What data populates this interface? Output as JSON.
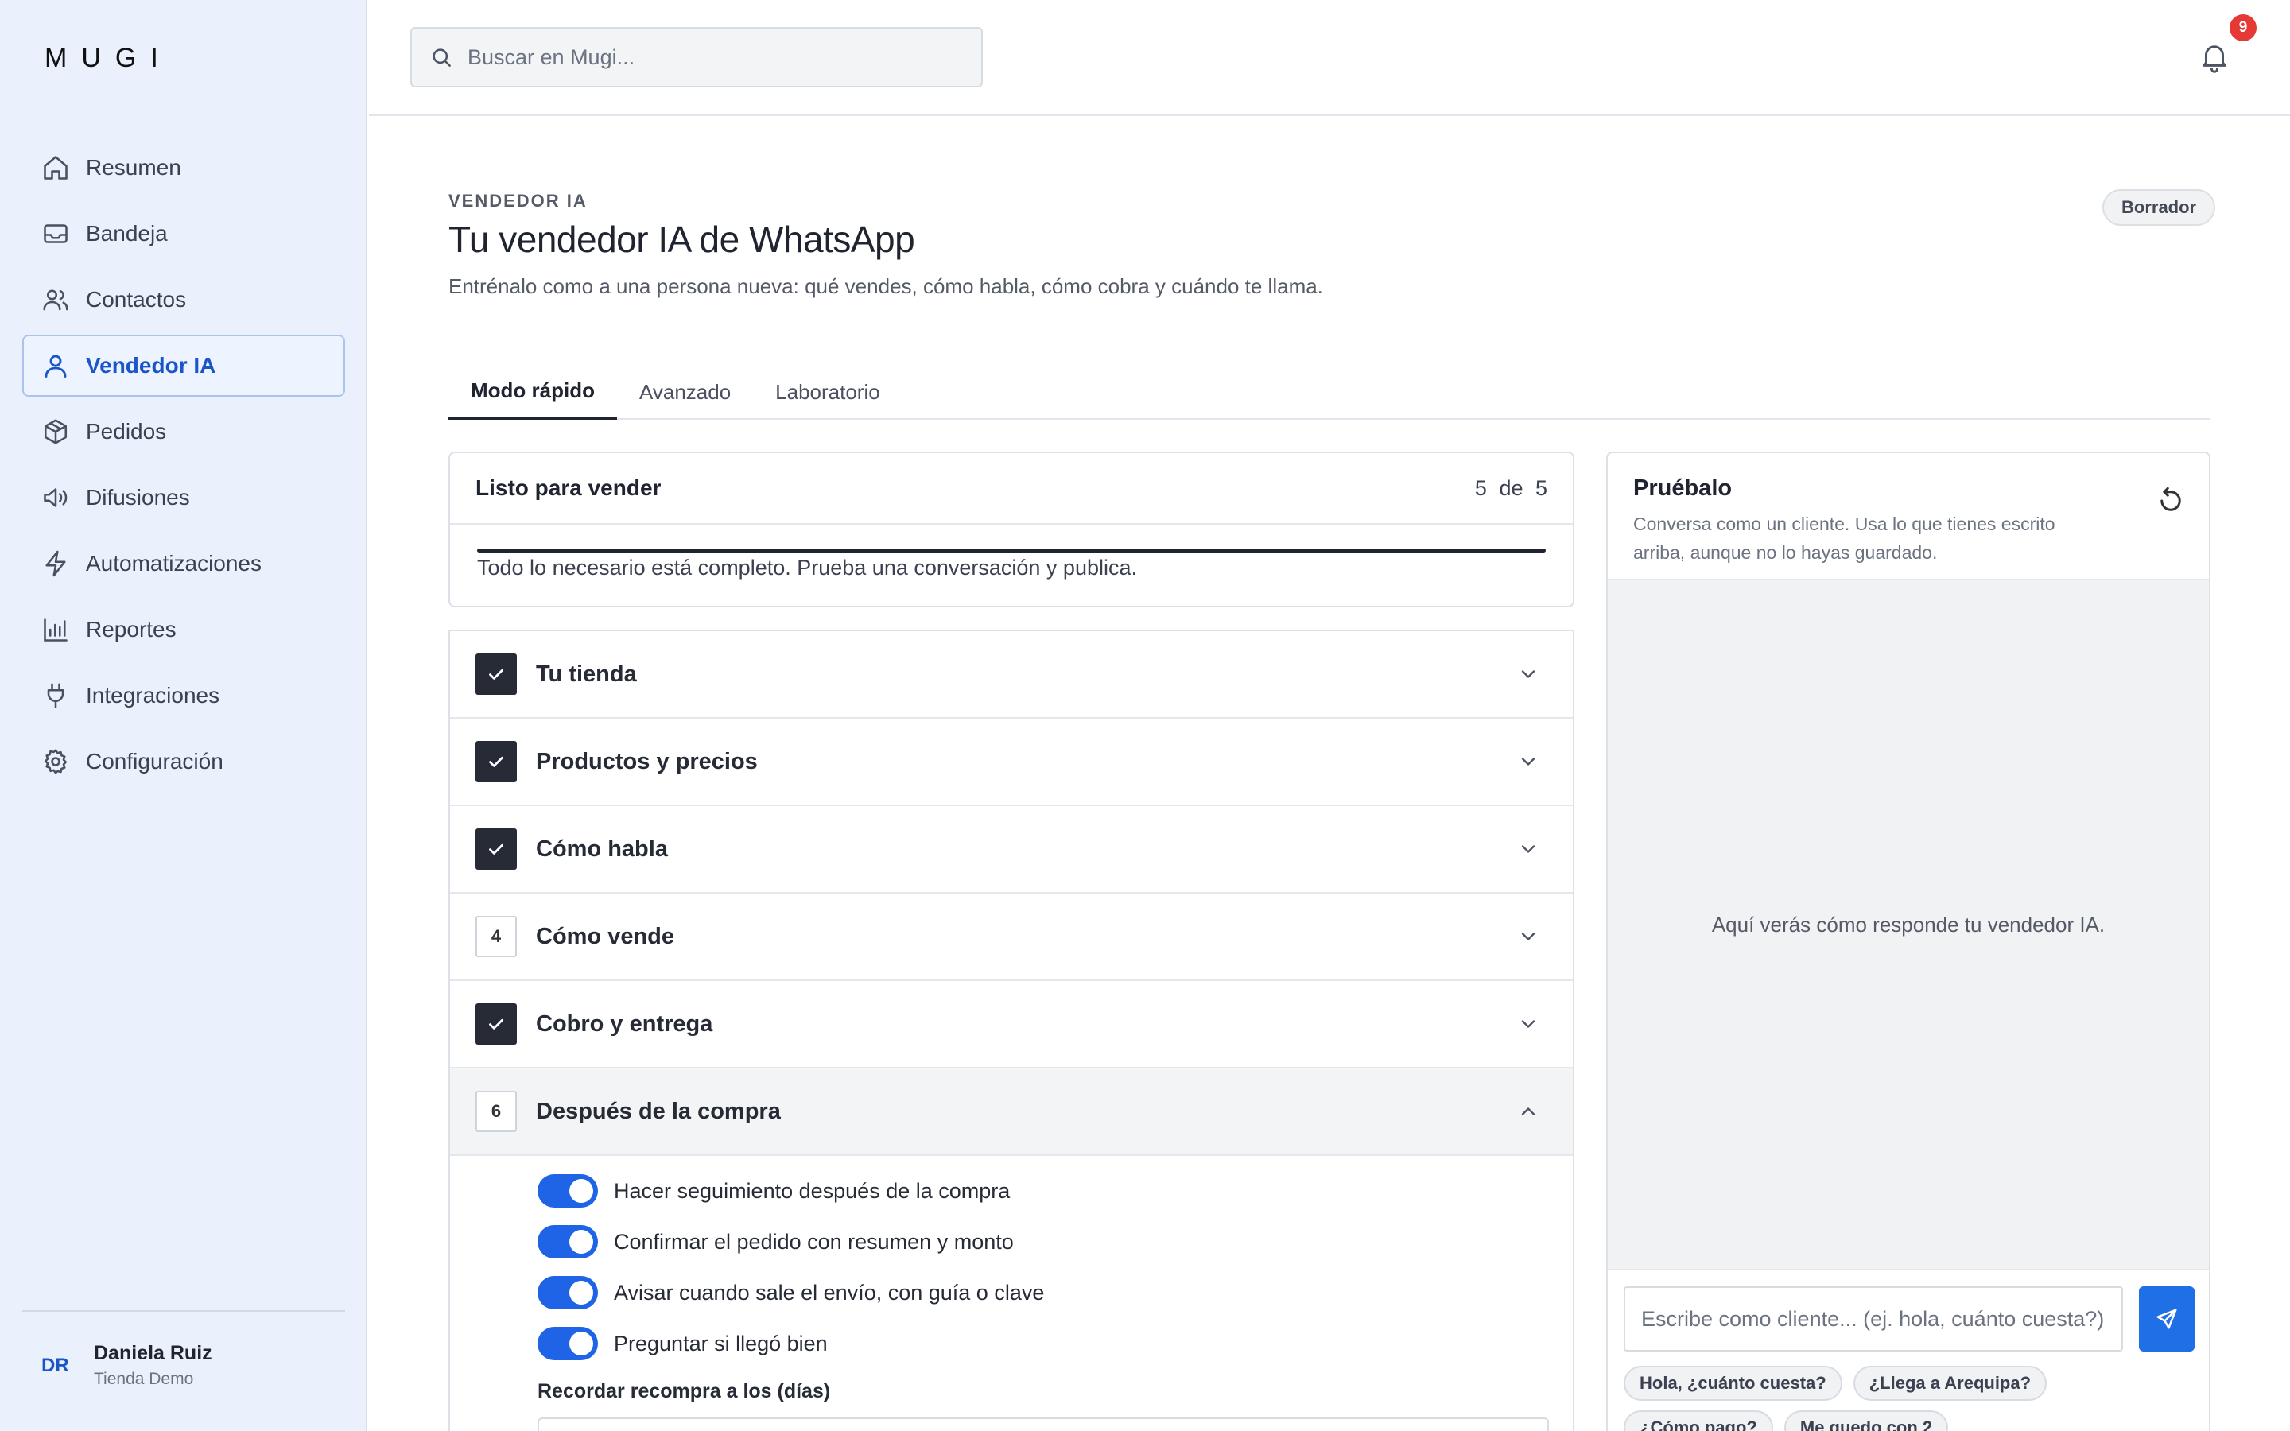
{
  "app": {
    "logo": "MUGI"
  },
  "sidebar": {
    "items": [
      {
        "label": "Resumen",
        "icon": "home-icon"
      },
      {
        "label": "Bandeja",
        "icon": "inbox-icon"
      },
      {
        "label": "Contactos",
        "icon": "users-icon"
      },
      {
        "label": "Vendedor IA",
        "icon": "user-icon",
        "active": true
      },
      {
        "label": "Pedidos",
        "icon": "package-icon"
      },
      {
        "label": "Difusiones",
        "icon": "megaphone-icon"
      },
      {
        "label": "Automatizaciones",
        "icon": "lightning-icon"
      },
      {
        "label": "Reportes",
        "icon": "bar-chart-icon"
      },
      {
        "label": "Integraciones",
        "icon": "plug-icon"
      },
      {
        "label": "Configuración",
        "icon": "gear-icon"
      }
    ],
    "user": {
      "initials": "DR",
      "name": "Daniela Ruiz",
      "store": "Tienda Demo"
    }
  },
  "topbar": {
    "search_placeholder": "Buscar en Mugi...",
    "notifications_count": "9"
  },
  "header": {
    "eyebrow": "VENDEDOR IA",
    "title": "Tu vendedor IA de WhatsApp",
    "subtitle": "Entrénalo como a una persona nueva: qué vendes, cómo habla, cómo cobra y cuándo te llama.",
    "status": "Borrador"
  },
  "tabs": [
    {
      "label": "Modo rápido",
      "active": true
    },
    {
      "label": "Avanzado"
    },
    {
      "label": "Laboratorio"
    }
  ],
  "ready": {
    "title": "Listo para vender",
    "count": "5 de 5",
    "progress": 1.0,
    "note": "Todo lo necesario está completo. Prueba una conversación y publica."
  },
  "steps": [
    {
      "label": "Tu tienda",
      "done": true,
      "number": "1"
    },
    {
      "label": "Productos y precios",
      "done": true,
      "number": "2"
    },
    {
      "label": "Cómo habla",
      "done": true,
      "number": "3"
    },
    {
      "label": "Cómo vende",
      "done": false,
      "number": "4"
    },
    {
      "label": "Cobro y entrega",
      "done": true,
      "number": "5"
    },
    {
      "label": "Después de la compra",
      "done": false,
      "number": "6",
      "open": true
    }
  ],
  "after_purchase": {
    "toggles": [
      {
        "label": "Hacer seguimiento después de la compra",
        "on": true
      },
      {
        "label": "Confirmar el pedido con resumen y monto",
        "on": true
      },
      {
        "label": "Avisar cuando sale el envío, con guía o clave",
        "on": true
      },
      {
        "label": "Preguntar si llegó bien",
        "on": true
      }
    ],
    "repurchase_label": "Recordar recompra a los (días)"
  },
  "chat": {
    "title": "Pruébalo",
    "subtitle": "Conversa como un cliente. Usa lo que tienes escrito arriba, aunque no lo hayas guardado.",
    "empty": "Aquí verás cómo responde tu vendedor IA.",
    "input_placeholder": "Escribe como cliente... (ej. hola, cuánto cuesta?)",
    "suggestions": [
      "Hola, ¿cuánto cuesta?",
      "¿Llega a Arequipa?",
      "¿Cómo pago?",
      "Me quedo con 2"
    ]
  },
  "colors": {
    "accent": "#1f63e6",
    "sidebar_bg": "#eaf1fd",
    "badge": "#e53935",
    "dark": "#262b36"
  }
}
